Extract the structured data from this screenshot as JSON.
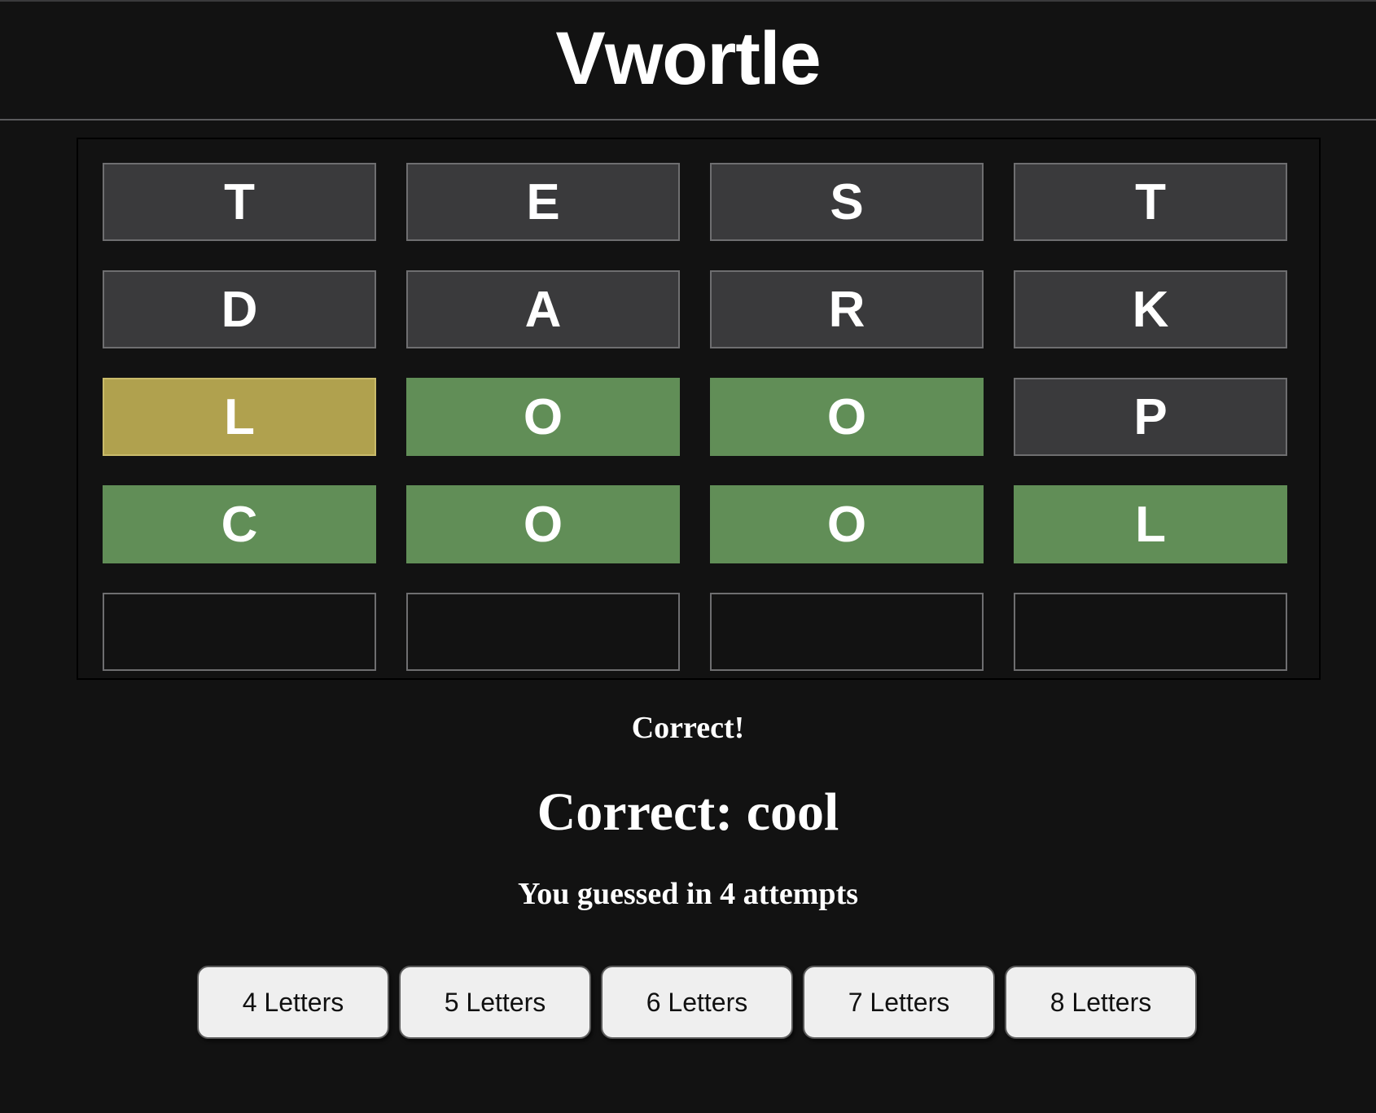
{
  "header": {
    "title": "Vwortle"
  },
  "board": {
    "rows": [
      [
        {
          "letter": "T",
          "state": "absent"
        },
        {
          "letter": "E",
          "state": "absent"
        },
        {
          "letter": "S",
          "state": "absent"
        },
        {
          "letter": "T",
          "state": "absent"
        }
      ],
      [
        {
          "letter": "D",
          "state": "absent"
        },
        {
          "letter": "A",
          "state": "absent"
        },
        {
          "letter": "R",
          "state": "absent"
        },
        {
          "letter": "K",
          "state": "absent"
        }
      ],
      [
        {
          "letter": "L",
          "state": "present"
        },
        {
          "letter": "O",
          "state": "correct"
        },
        {
          "letter": "O",
          "state": "correct"
        },
        {
          "letter": "P",
          "state": "absent"
        }
      ],
      [
        {
          "letter": "C",
          "state": "correct"
        },
        {
          "letter": "O",
          "state": "correct"
        },
        {
          "letter": "O",
          "state": "correct"
        },
        {
          "letter": "L",
          "state": "correct"
        }
      ],
      [
        {
          "letter": "",
          "state": "empty"
        },
        {
          "letter": "",
          "state": "empty"
        },
        {
          "letter": "",
          "state": "empty"
        },
        {
          "letter": "",
          "state": "empty"
        }
      ]
    ]
  },
  "colors": {
    "absent": "#3a3a3c",
    "present": "#b0a14e",
    "correct": "#618e57",
    "background": "#121212"
  },
  "result": {
    "status": "Correct!",
    "answer": "Correct: cool",
    "attempts": "You guessed in 4 attempts"
  },
  "length_buttons": [
    {
      "label": "4 Letters"
    },
    {
      "label": "5 Letters"
    },
    {
      "label": "6 Letters"
    },
    {
      "label": "7 Letters"
    },
    {
      "label": "8 Letters"
    }
  ]
}
